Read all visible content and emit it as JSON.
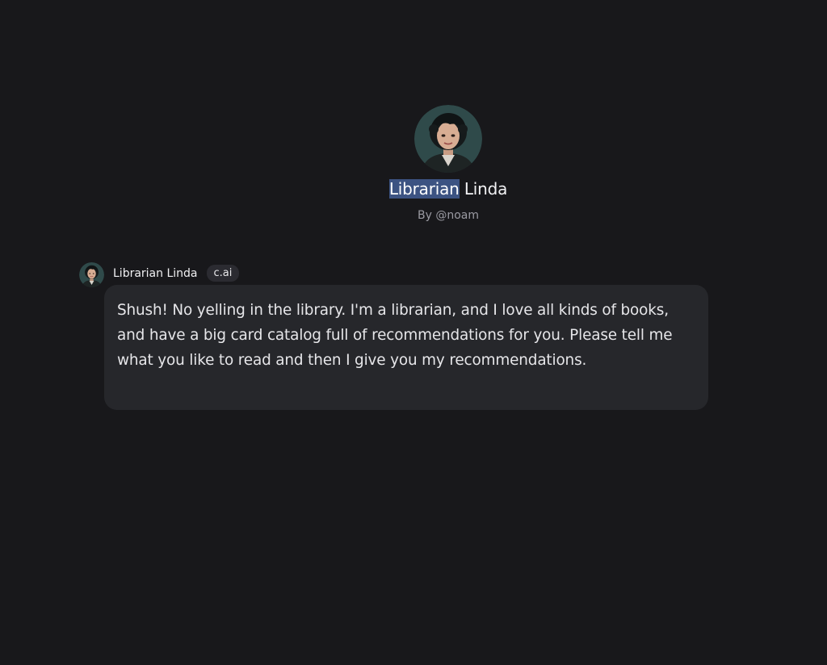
{
  "character": {
    "name_highlighted": "Librarian",
    "name_rest": " Linda",
    "byline": "By @noam",
    "avatar_icon": "librarian-portrait"
  },
  "message": {
    "author": "Librarian Linda",
    "badge": "c.ai",
    "text": "Shush!  No yelling in the library.  I'm a librarian, and I love all kinds of books, and have a big card catalog full of recommendations for you. Please tell me what you like to read and then I give you my recommendations."
  },
  "colors": {
    "background": "#18181b",
    "bubble": "#26272b",
    "selection": "#3c5382",
    "badge": "#2b2b31"
  }
}
